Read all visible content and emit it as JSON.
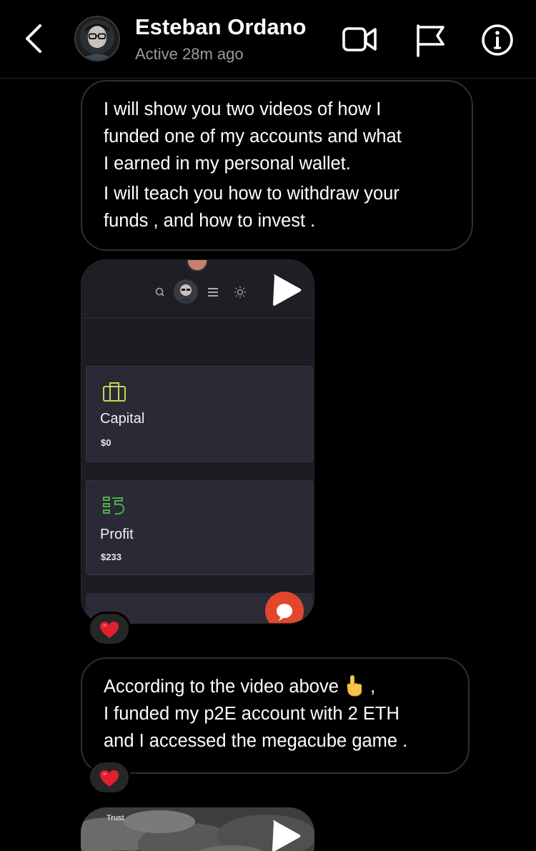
{
  "header": {
    "name": "Esteban Ordano",
    "status": "Active 28m ago"
  },
  "messages": {
    "msg1": {
      "lines": [
        "I will show you two videos of how I",
        "funded one of my accounts and what",
        "I earned in my personal wallet.",
        "I will teach you how to withdraw your",
        "funds , and how to invest ."
      ]
    },
    "video1": {
      "cards": [
        {
          "title": "Capital",
          "value": "$0",
          "icon": "briefcase-icon",
          "color": "#cbd45a"
        },
        {
          "title": "Profit",
          "value": "$233",
          "icon": "profit-icon",
          "color": "#4fb04a"
        }
      ],
      "reaction": "❤️"
    },
    "msg2": {
      "lines": [
        "According to the video above",
        " ,",
        "I funded my p2E account with 2 ETH",
        "and I accessed the megacube game ."
      ],
      "emoji": "pointing-up-hand",
      "reaction": "❤️"
    },
    "video2": {
      "label": "Trust"
    }
  },
  "colors": {
    "background": "#000000",
    "bubble_border": "#2f2f2f",
    "secondary_text": "#9a9a9a",
    "reaction_bg": "#262626",
    "heart": "#e0202d"
  }
}
